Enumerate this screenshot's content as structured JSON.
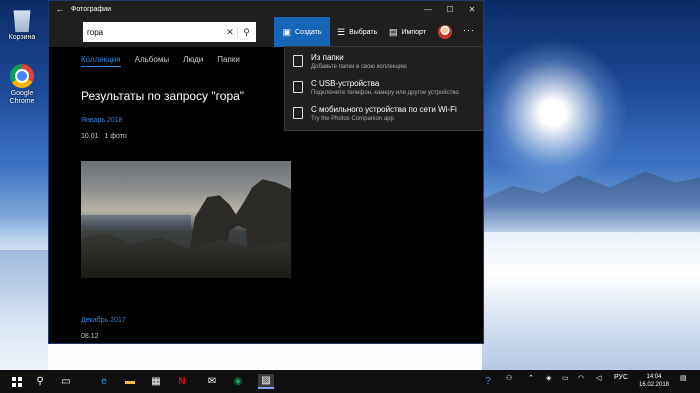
{
  "desktop": {
    "icons": [
      {
        "label": "Корзина",
        "icon": "recycle-bin-icon"
      },
      {
        "label": "Google Chrome",
        "icon": "chrome-icon"
      }
    ]
  },
  "window": {
    "title": "Фотографии",
    "search": {
      "value": "гора"
    },
    "toolbar": {
      "create": "Создать",
      "select": "Выбрать",
      "import": "Импорт"
    },
    "tabs": [
      "Коллекция",
      "Альбомы",
      "Люди",
      "Папки"
    ],
    "results_title": "Результаты по запросу \"гора\"",
    "groups": [
      {
        "month": "Январь 2018",
        "date": "10.01",
        "count": "1 фото"
      },
      {
        "month": "Декабрь 2017",
        "date": "08.12"
      }
    ],
    "create_menu": [
      {
        "label": "Из папки",
        "sub": "Добавьте папки в свою коллекцию"
      },
      {
        "label": "С USB-устройства",
        "sub": "Подключите телефон, камеру или другое устройство"
      },
      {
        "label": "С мобильного устройства по сети Wi-Fi",
        "sub": "Try the Photos Companion app"
      }
    ]
  },
  "taskbar": {
    "language": "РУС",
    "time": "14:04",
    "date": "16.02.2018"
  },
  "colors": {
    "accent": "#1666b8",
    "link": "#2b8ae0"
  }
}
